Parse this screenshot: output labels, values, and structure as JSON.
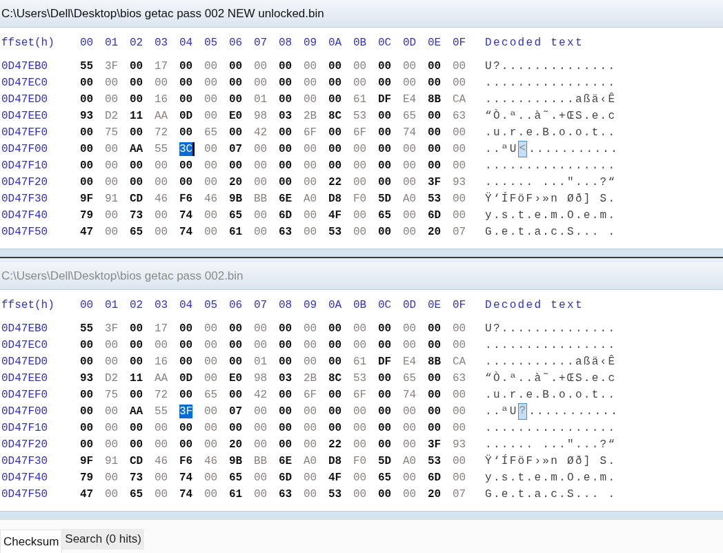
{
  "panels": [
    {
      "title": "C:\\Users\\Dell\\Desktop\\bios getac pass 002 NEW unlocked.bin",
      "active": true,
      "caret": true,
      "header": {
        "offset": "ffset(h)",
        "columns": [
          "00",
          "01",
          "02",
          "03",
          "04",
          "05",
          "06",
          "07",
          "08",
          "09",
          "0A",
          "0B",
          "0C",
          "0D",
          "0E",
          "0F"
        ],
        "decoded": "Decoded text"
      },
      "rows": [
        {
          "offset": "0D47EB0",
          "bytes": [
            "55",
            "3F",
            "00",
            "17",
            "00",
            "00",
            "00",
            "00",
            "00",
            "00",
            "00",
            "00",
            "00",
            "00",
            "00",
            "00"
          ],
          "decoded": "U?.............."
        },
        {
          "offset": "0D47EC0",
          "bytes": [
            "00",
            "00",
            "00",
            "00",
            "00",
            "00",
            "00",
            "00",
            "00",
            "00",
            "00",
            "00",
            "00",
            "00",
            "00",
            "00"
          ],
          "decoded": "................"
        },
        {
          "offset": "0D47ED0",
          "bytes": [
            "00",
            "00",
            "00",
            "16",
            "00",
            "00",
            "00",
            "01",
            "00",
            "00",
            "00",
            "61",
            "DF",
            "E4",
            "8B",
            "CA"
          ],
          "decoded": "...........aßä‹Ê"
        },
        {
          "offset": "0D47EE0",
          "bytes": [
            "93",
            "D2",
            "11",
            "AA",
            "0D",
            "00",
            "E0",
            "98",
            "03",
            "2B",
            "8C",
            "53",
            "00",
            "65",
            "00",
            "63"
          ],
          "decoded": "“Ò.ª..à˜.+ŒS.e.c"
        },
        {
          "offset": "0D47EF0",
          "bytes": [
            "00",
            "75",
            "00",
            "72",
            "00",
            "65",
            "00",
            "42",
            "00",
            "6F",
            "00",
            "6F",
            "00",
            "74",
            "00",
            "00"
          ],
          "decoded": ".u.r.e.B.o.o.t.."
        },
        {
          "offset": "0D47F00",
          "bytes": [
            "00",
            "00",
            "AA",
            "55",
            {
              "hex": "3C",
              "selected": true
            },
            "00",
            "07",
            "00",
            "00",
            "00",
            "00",
            "00",
            "00",
            "00",
            "00",
            "00"
          ],
          "decoded": [
            {
              "text": "..ªU",
              "selected": false
            },
            {
              "text": "<",
              "selected": true
            },
            {
              "text": "...........",
              "selected": false
            }
          ]
        },
        {
          "offset": "0D47F10",
          "bytes": [
            "00",
            "00",
            "00",
            "00",
            "00",
            "00",
            "00",
            "00",
            "00",
            "00",
            "00",
            "00",
            "00",
            "00",
            "00",
            "00"
          ],
          "decoded": "................"
        },
        {
          "offset": "0D47F20",
          "bytes": [
            "00",
            "00",
            "00",
            "00",
            "00",
            "00",
            "20",
            "00",
            "00",
            "00",
            "22",
            "00",
            "00",
            "00",
            "3F",
            "93"
          ],
          "decoded": "...... ...\"...?“"
        },
        {
          "offset": "0D47F30",
          "bytes": [
            "9F",
            "91",
            "CD",
            "46",
            "F6",
            "46",
            "9B",
            "BB",
            "6E",
            "A0",
            "D8",
            "F0",
            "5D",
            "A0",
            "53",
            "00"
          ],
          "decoded": "Ÿ‘ÍFöF›»n Øð] S."
        },
        {
          "offset": "0D47F40",
          "bytes": [
            "79",
            "00",
            "73",
            "00",
            "74",
            "00",
            "65",
            "00",
            "6D",
            "00",
            "4F",
            "00",
            "65",
            "00",
            "6D",
            "00"
          ],
          "decoded": "y.s.t.e.m.O.e.m."
        },
        {
          "offset": "0D47F50",
          "bytes": [
            "47",
            "00",
            "65",
            "00",
            "74",
            "00",
            "61",
            "00",
            "63",
            "00",
            "53",
            "00",
            "00",
            "00",
            "20",
            "07"
          ],
          "decoded": "G.e.t.a.c.S... ."
        }
      ]
    },
    {
      "title": "C:\\Users\\Dell\\Desktop\\bios getac pass 002.bin",
      "active": false,
      "caret": false,
      "header": {
        "offset": "ffset(h)",
        "columns": [
          "00",
          "01",
          "02",
          "03",
          "04",
          "05",
          "06",
          "07",
          "08",
          "09",
          "0A",
          "0B",
          "0C",
          "0D",
          "0E",
          "0F"
        ],
        "decoded": "Decoded text"
      },
      "rows": [
        {
          "offset": "0D47EB0",
          "bytes": [
            "55",
            "3F",
            "00",
            "17",
            "00",
            "00",
            "00",
            "00",
            "00",
            "00",
            "00",
            "00",
            "00",
            "00",
            "00",
            "00"
          ],
          "decoded": "U?.............."
        },
        {
          "offset": "0D47EC0",
          "bytes": [
            "00",
            "00",
            "00",
            "00",
            "00",
            "00",
            "00",
            "00",
            "00",
            "00",
            "00",
            "00",
            "00",
            "00",
            "00",
            "00"
          ],
          "decoded": "................"
        },
        {
          "offset": "0D47ED0",
          "bytes": [
            "00",
            "00",
            "00",
            "16",
            "00",
            "00",
            "00",
            "01",
            "00",
            "00",
            "00",
            "61",
            "DF",
            "E4",
            "8B",
            "CA"
          ],
          "decoded": "...........aßä‹Ê"
        },
        {
          "offset": "0D47EE0",
          "bytes": [
            "93",
            "D2",
            "11",
            "AA",
            "0D",
            "00",
            "E0",
            "98",
            "03",
            "2B",
            "8C",
            "53",
            "00",
            "65",
            "00",
            "63"
          ],
          "decoded": "“Ò.ª..à˜.+ŒS.e.c"
        },
        {
          "offset": "0D47EF0",
          "bytes": [
            "00",
            "75",
            "00",
            "72",
            "00",
            "65",
            "00",
            "42",
            "00",
            "6F",
            "00",
            "6F",
            "00",
            "74",
            "00",
            "00"
          ],
          "decoded": ".u.r.e.B.o.o.t.."
        },
        {
          "offset": "0D47F00",
          "bytes": [
            "00",
            "00",
            "AA",
            "55",
            {
              "hex": "3F",
              "selected": true
            },
            "00",
            "07",
            "00",
            "00",
            "00",
            "00",
            "00",
            "00",
            "00",
            "00",
            "00"
          ],
          "decoded": [
            {
              "text": "..ªU",
              "selected": false
            },
            {
              "text": "?",
              "selected": true
            },
            {
              "text": "...........",
              "selected": false
            }
          ]
        },
        {
          "offset": "0D47F10",
          "bytes": [
            "00",
            "00",
            "00",
            "00",
            "00",
            "00",
            "00",
            "00",
            "00",
            "00",
            "00",
            "00",
            "00",
            "00",
            "00",
            "00"
          ],
          "decoded": "................"
        },
        {
          "offset": "0D47F20",
          "bytes": [
            "00",
            "00",
            "00",
            "00",
            "00",
            "00",
            "20",
            "00",
            "00",
            "00",
            "22",
            "00",
            "00",
            "00",
            "3F",
            "93"
          ],
          "decoded": "...... ...\"...?“"
        },
        {
          "offset": "0D47F30",
          "bytes": [
            "9F",
            "91",
            "CD",
            "46",
            "F6",
            "46",
            "9B",
            "BB",
            "6E",
            "A0",
            "D8",
            "F0",
            "5D",
            "A0",
            "53",
            "00"
          ],
          "decoded": "Ÿ‘ÍFöF›»n Øð] S."
        },
        {
          "offset": "0D47F40",
          "bytes": [
            "79",
            "00",
            "73",
            "00",
            "74",
            "00",
            "65",
            "00",
            "6D",
            "00",
            "4F",
            "00",
            "65",
            "00",
            "6D",
            "00"
          ],
          "decoded": "y.s.t.e.m.O.e.m."
        },
        {
          "offset": "0D47F50",
          "bytes": [
            "47",
            "00",
            "65",
            "00",
            "74",
            "00",
            "61",
            "00",
            "63",
            "00",
            "53",
            "00",
            "00",
            "00",
            "20",
            "07"
          ],
          "decoded": "G.e.t.a.c.S... ."
        }
      ]
    }
  ],
  "tabs": [
    {
      "label": "Checksum",
      "selected": true
    },
    {
      "label": "Search (0 hits)",
      "selected": false
    }
  ]
}
